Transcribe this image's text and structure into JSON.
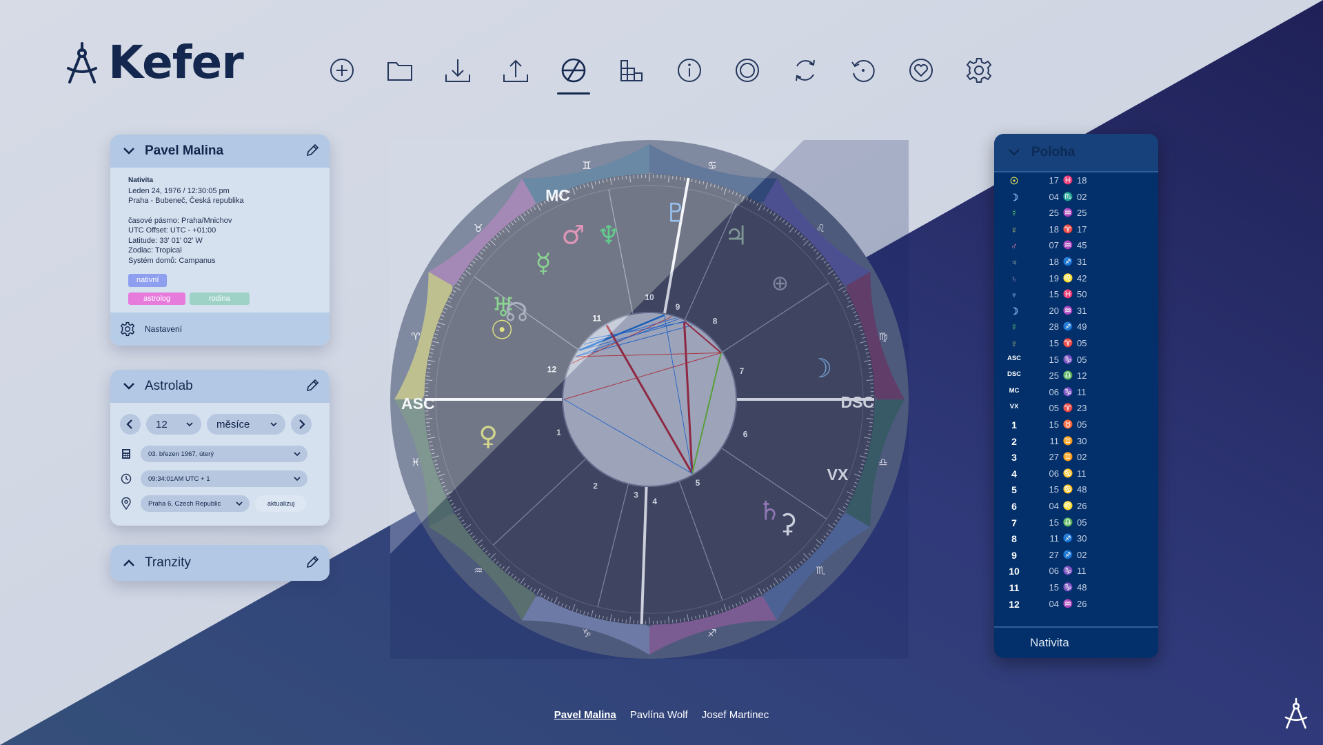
{
  "app": {
    "name": "Kefer"
  },
  "toolbar": [
    {
      "icon": "add-icon"
    },
    {
      "icon": "folder-icon"
    },
    {
      "icon": "download-icon"
    },
    {
      "icon": "upload-icon"
    },
    {
      "icon": "chart-wheel-icon",
      "active": true
    },
    {
      "icon": "bar-chart-icon"
    },
    {
      "icon": "info-icon"
    },
    {
      "icon": "target-icon"
    },
    {
      "icon": "refresh-icon"
    },
    {
      "icon": "rotate-icon"
    },
    {
      "icon": "heart-icon"
    },
    {
      "icon": "gear-icon"
    }
  ],
  "profile": {
    "name": "Pavel Malina",
    "type_label": "Nativita",
    "date": "Leden 24, 1976 / 12:30:05 pm",
    "place": "Praha - Bubeneč, Česká republika",
    "timezone": "časové pásmo: Praha/Mnichov",
    "utc_offset": "UTC Offset: UTC - +01:00",
    "latitude": "Latitude: 33' 01' 02' W",
    "zodiac": "Zodiac: Tropical",
    "houses": "Systém domů: Campanus",
    "tags": [
      {
        "label": "nativní",
        "color": "#8f9ff0"
      },
      {
        "label": "astrolog",
        "color": "#e77bdc"
      },
      {
        "label": "rodina",
        "color": "#9fd2c7"
      }
    ],
    "settings_label": "Nastavení"
  },
  "astrolab": {
    "title": "Astrolab",
    "step_value": "12",
    "unit": "měsíce",
    "date": "03. březen 1967, úterý",
    "time": "09:34:01AM  UTC + 1",
    "place": "Praha 6, Czech Republic",
    "update_label": "aktualizuj"
  },
  "tranzity": {
    "title": "Tranzity"
  },
  "positions": {
    "title": "Poloha",
    "footer": "Nativita",
    "rows": [
      {
        "glyph": "☉",
        "color": "#e6e35a",
        "deg": "17",
        "sign": "♓",
        "sign_color": "#3fb0d9",
        "min": "18"
      },
      {
        "glyph": "☽",
        "color": "#7fb3ee",
        "deg": "04",
        "sign": "♏",
        "sign_color": "#b276c9",
        "min": "02"
      },
      {
        "glyph": "☿",
        "color": "#5cc46e",
        "deg": "25",
        "sign": "♒",
        "sign_color": "#d9d05a",
        "min": "25"
      },
      {
        "glyph": "♀",
        "color": "#cfd36a",
        "deg": "18",
        "sign": "♈",
        "sign_color": "#e06b6b",
        "min": "17"
      },
      {
        "glyph": "♂",
        "color": "#e07aa4",
        "deg": "07",
        "sign": "♒",
        "sign_color": "#d9d05a",
        "min": "45"
      },
      {
        "glyph": "♃",
        "color": "#9bb6a3",
        "deg": "18",
        "sign": "♐",
        "sign_color": "#5cc46e",
        "min": "31"
      },
      {
        "glyph": "♄",
        "color": "#b28dc9",
        "deg": "19",
        "sign": "♌",
        "sign_color": "#d9d05a",
        "min": "42"
      },
      {
        "glyph": "♆",
        "color": "#7fb3ee",
        "deg": "15",
        "sign": "♓",
        "sign_color": "#3fb0d9",
        "min": "50"
      },
      {
        "glyph": "☽",
        "color": "#7fb3ee",
        "deg": "20",
        "sign": "♒",
        "sign_color": "#d9d05a",
        "min": "31"
      },
      {
        "glyph": "☿",
        "color": "#5cc46e",
        "deg": "28",
        "sign": "♐",
        "sign_color": "#5cc46e",
        "min": "49"
      },
      {
        "glyph": "♀",
        "color": "#cfd36a",
        "deg": "15",
        "sign": "♈",
        "sign_color": "#e06b6b",
        "min": "05"
      },
      {
        "glyph": "ASC",
        "color": "#ffffff",
        "deg": "15",
        "sign": "♑",
        "sign_color": "#5cc46e",
        "min": "05"
      },
      {
        "glyph": "DSC",
        "color": "#ffffff",
        "deg": "25",
        "sign": "♎",
        "sign_color": "#d9d05a",
        "min": "12"
      },
      {
        "glyph": "MC",
        "color": "#ffffff",
        "deg": "06",
        "sign": "♑",
        "sign_color": "#b276c9",
        "min": "11"
      },
      {
        "glyph": "VX",
        "color": "#ffffff",
        "deg": "05",
        "sign": "♈",
        "sign_color": "#e06b6b",
        "min": "23"
      },
      {
        "glyph": "1",
        "color": "#ffffff",
        "deg": "15",
        "sign": "♉",
        "sign_color": "#b276c9",
        "min": "05"
      },
      {
        "glyph": "2",
        "color": "#ffffff",
        "deg": "11",
        "sign": "♊",
        "sign_color": "#3fb0d9",
        "min": "30"
      },
      {
        "glyph": "3",
        "color": "#ffffff",
        "deg": "27",
        "sign": "♊",
        "sign_color": "#3fb0d9",
        "min": "02"
      },
      {
        "glyph": "4",
        "color": "#ffffff",
        "deg": "06",
        "sign": "♋",
        "sign_color": "#5cc46e",
        "min": "11"
      },
      {
        "glyph": "5",
        "color": "#ffffff",
        "deg": "15",
        "sign": "♋",
        "sign_color": "#5cc46e",
        "min": "48"
      },
      {
        "glyph": "6",
        "color": "#ffffff",
        "deg": "04",
        "sign": "♌",
        "sign_color": "#d9d05a",
        "min": "26"
      },
      {
        "glyph": "7",
        "color": "#ffffff",
        "deg": "15",
        "sign": "♎",
        "sign_color": "#d9d05a",
        "min": "05"
      },
      {
        "glyph": "8",
        "color": "#ffffff",
        "deg": "11",
        "sign": "♐",
        "sign_color": "#5cc46e",
        "min": "30"
      },
      {
        "glyph": "9",
        "color": "#ffffff",
        "deg": "27",
        "sign": "♐",
        "sign_color": "#5cc46e",
        "min": "02"
      },
      {
        "glyph": "10",
        "color": "#ffffff",
        "deg": "06",
        "sign": "♑",
        "sign_color": "#5cc46e",
        "min": "11"
      },
      {
        "glyph": "11",
        "color": "#ffffff",
        "deg": "15",
        "sign": "♑",
        "sign_color": "#5cc46e",
        "min": "48"
      },
      {
        "glyph": "12",
        "color": "#ffffff",
        "deg": "04",
        "sign": "♒",
        "sign_color": "#d9d05a",
        "min": "26"
      }
    ]
  },
  "chart": {
    "axis_labels": [
      "ASC",
      "DSC",
      "MC",
      "VX"
    ],
    "zodiac": [
      {
        "glyph": "♈",
        "color": "#c4c36a"
      },
      {
        "glyph": "♉",
        "color": "#9a6aa8"
      },
      {
        "glyph": "♊",
        "color": "#3b6a8a"
      },
      {
        "glyph": "♋",
        "color": "#2f4f7c"
      },
      {
        "glyph": "♌",
        "color": "#5a5aa2"
      },
      {
        "glyph": "♍",
        "color": "#7a3f6a"
      },
      {
        "glyph": "♎",
        "color": "#3b6a63"
      },
      {
        "glyph": "♏",
        "color": "#5b77a8"
      },
      {
        "glyph": "♐",
        "color": "#a06ca6"
      },
      {
        "glyph": "♑",
        "color": "#8d9ac2"
      },
      {
        "glyph": "♒",
        "color": "#6f8a72"
      },
      {
        "glyph": "♓",
        "color": "#5f7f6c"
      }
    ],
    "house_numbers": [
      "1",
      "2",
      "3",
      "4",
      "5",
      "6",
      "7",
      "8",
      "9",
      "10",
      "11",
      "12"
    ],
    "planets": [
      {
        "glyph": "☉",
        "color": "#e6e35a"
      },
      {
        "glyph": "♅",
        "color": "#6ccf6e"
      },
      {
        "glyph": "☊",
        "color": "#9aa0ad"
      },
      {
        "glyph": "☿",
        "color": "#6ccf6e"
      },
      {
        "glyph": "♂",
        "color": "#e07aa4"
      },
      {
        "glyph": "♆",
        "color": "#36c46a"
      },
      {
        "glyph": "♇",
        "color": "#7fb3ee"
      },
      {
        "glyph": "♃",
        "color": "#9bb6a3"
      },
      {
        "glyph": "⊕",
        "color": "#9aa0ad"
      },
      {
        "glyph": "☽",
        "color": "#8ec1f2"
      },
      {
        "glyph": "♄",
        "color": "#b28dc9"
      },
      {
        "glyph": "⚳",
        "color": "#ffffff"
      },
      {
        "glyph": "♀",
        "color": "#cfd36a"
      }
    ]
  },
  "people": [
    {
      "name": "Pavel Malina",
      "current": true
    },
    {
      "name": "Pavlína Wolf",
      "current": false
    },
    {
      "name": "Josef Martinec",
      "current": false
    }
  ]
}
